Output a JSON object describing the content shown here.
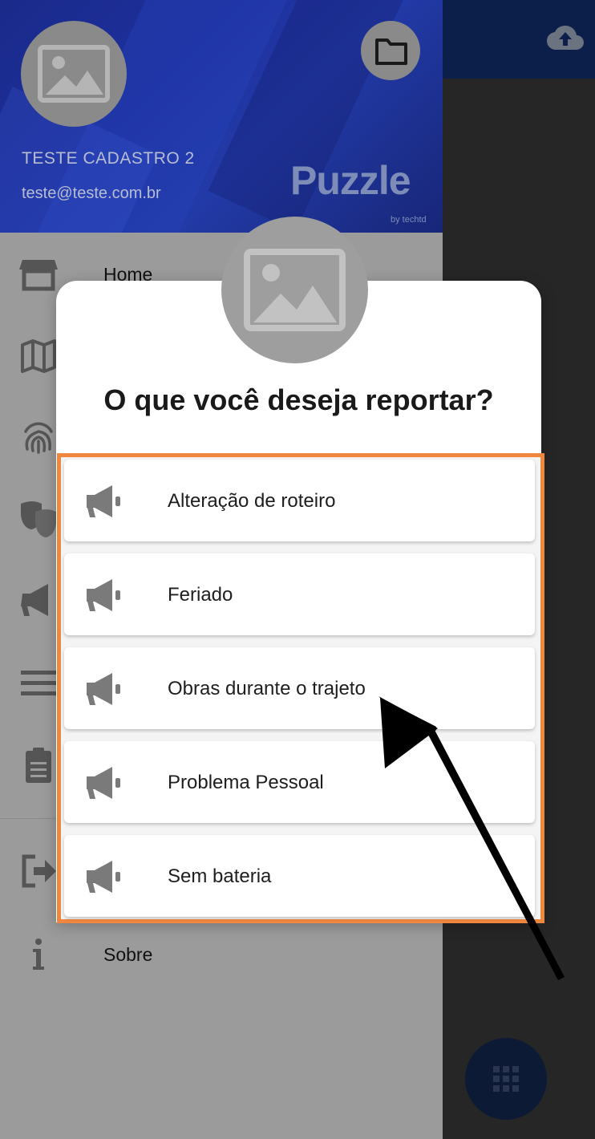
{
  "drawer": {
    "user_name": "TESTE CADASTRO 2",
    "user_email": "teste@teste.com.br",
    "brand": "Puzzle",
    "brand_sub": "by techtd",
    "menu": [
      {
        "label": "Home",
        "icon": "store-icon"
      },
      {
        "label": "",
        "icon": "map-icon"
      },
      {
        "label": "",
        "icon": "fingerprint-icon"
      },
      {
        "label": "",
        "icon": "theater-masks-icon"
      },
      {
        "label": "",
        "icon": "megaphone-icon"
      },
      {
        "label": "",
        "icon": "list-icon"
      },
      {
        "label": "",
        "icon": "clipboard-icon"
      },
      {
        "label": "",
        "icon": "logout-icon"
      },
      {
        "label": "Sobre",
        "icon": "info-icon"
      }
    ]
  },
  "dialog": {
    "title": "O que você deseja reportar?",
    "options": [
      {
        "label": "Alteração de roteiro",
        "icon": "megaphone-icon"
      },
      {
        "label": "Feriado",
        "icon": "megaphone-icon"
      },
      {
        "label": "Obras durante o trajeto",
        "icon": "megaphone-icon"
      },
      {
        "label": "Problema Pessoal",
        "icon": "megaphone-icon"
      },
      {
        "label": "Sem bateria",
        "icon": "megaphone-icon"
      }
    ]
  },
  "colors": {
    "highlight_border": "#f0873e",
    "drawer_header": "#1d2f9d",
    "app_topbar": "#0b1f4a",
    "overlay_gray": "#9b9b9b"
  }
}
